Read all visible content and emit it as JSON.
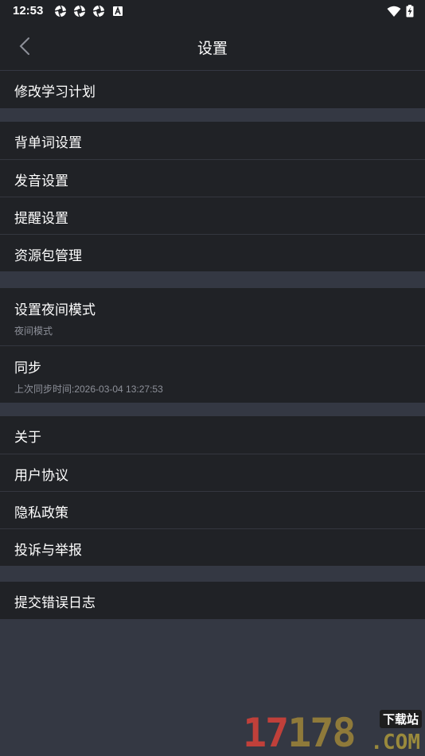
{
  "status_bar": {
    "time": "12:53"
  },
  "header": {
    "title": "设置"
  },
  "groups": [
    {
      "items": [
        {
          "label": "修改学习计划"
        }
      ]
    },
    {
      "items": [
        {
          "label": "背单词设置"
        },
        {
          "label": "发音设置"
        },
        {
          "label": "提醒设置"
        },
        {
          "label": "资源包管理"
        }
      ]
    },
    {
      "items": [
        {
          "label": "设置夜间模式",
          "sub": "夜间模式"
        },
        {
          "label": "同步",
          "sub": "上次同步时间:2026-03-04 13:27:53"
        }
      ]
    },
    {
      "items": [
        {
          "label": "关于"
        },
        {
          "label": "用户协议"
        },
        {
          "label": "隐私政策"
        },
        {
          "label": "投诉与举报"
        }
      ]
    },
    {
      "items": [
        {
          "label": "提交错误日志"
        }
      ]
    }
  ],
  "watermark": {
    "digits_a": "17",
    "digits_b": "178",
    "tag": "下载站",
    "suffix": ".COM"
  },
  "colors": {
    "page_bg": "#343843",
    "panel_bg": "#202226",
    "subtext": "#8d9099"
  }
}
